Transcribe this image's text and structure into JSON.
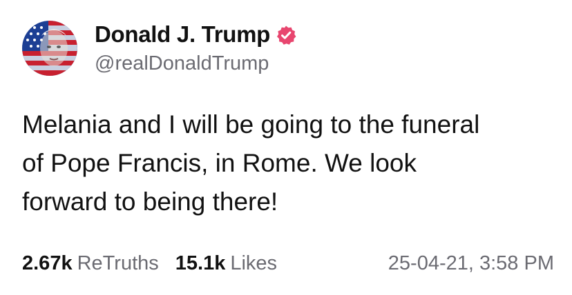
{
  "author": {
    "display_name": "Donald J. Trump",
    "handle": "@realDonaldTrump",
    "verified": true,
    "avatar_icon": "flag-portrait-avatar"
  },
  "post": {
    "lines": [
      "Melania and I will be going to the funeral",
      "of Pope Francis, in Rome. We look",
      "forward to being there!"
    ]
  },
  "stats": {
    "retruths_count": "2.67k",
    "retruths_label": "ReTruths",
    "likes_count": "15.1k",
    "likes_label": "Likes",
    "timestamp": "25-04-21, 3:58 PM"
  },
  "colors": {
    "verified_badge": "#e8466f",
    "secondary_text": "#6b6b72",
    "primary_text": "#111111"
  }
}
